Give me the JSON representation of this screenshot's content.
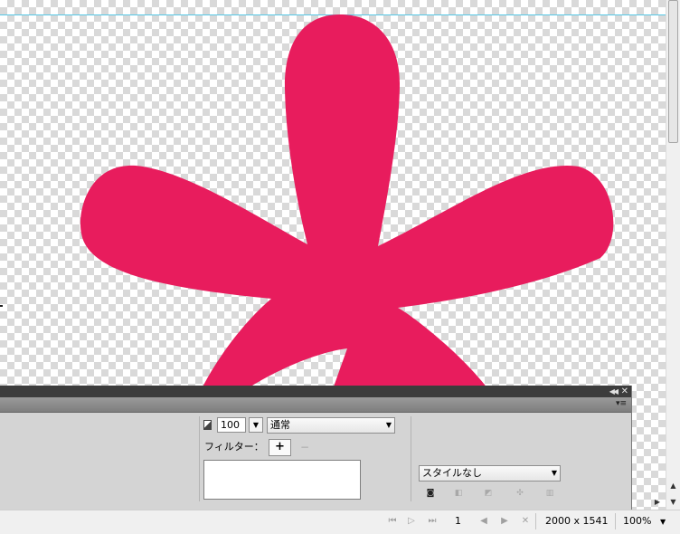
{
  "colors": {
    "shape_fill": "#e81c5d",
    "guide_line": "#55c8e6",
    "panel_bg": "#d4d4d4",
    "panel_titlebar": "#3c3c3c"
  },
  "properties_panel": {
    "opacity_value": "100",
    "blend_mode": "通常",
    "filter_label": "フィルター：",
    "add_filter_symbol": "+",
    "remove_filter_symbol": "−",
    "style_select": "スタイルなし"
  },
  "icons": {
    "collapse": "double-chevron-left-icon",
    "close": "close-icon",
    "panel_menu": "panel-menu-icon",
    "opacity": "opacity-icon",
    "new_style": "new-style-icon",
    "break_link": "break-link-icon",
    "update_style": "update-style-icon",
    "style_edit": "style-edit-icon",
    "delete_style": "trash-icon"
  },
  "statusbar": {
    "page_number": "1",
    "document_size": "2000 x 1541",
    "zoom": "100%"
  }
}
